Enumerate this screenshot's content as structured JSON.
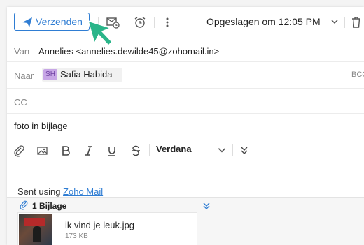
{
  "toolbar": {
    "send_label": "Verzenden",
    "saved_status": "Opgeslagen om 12:05 PM"
  },
  "fields": {
    "from_label": "Van",
    "from_value": "Annelies <annelies.dewilde45@zohomail.in>",
    "to_label": "Naar",
    "to_initials": "SH",
    "to_name": "Safia Habida",
    "bcc_label": "BCC",
    "cc_label": "CC",
    "subject": "foto in bijlage"
  },
  "format_toolbar": {
    "font": "Verdana"
  },
  "body": {
    "signature_prefix": "Sent using ",
    "signature_link": "Zoho Mail"
  },
  "attachments": {
    "count_label": "1 Bijlage",
    "items": [
      {
        "name": "ik vind je leuk.jpg",
        "size": "173 KB"
      }
    ]
  },
  "colors": {
    "accent": "#2f7dd3",
    "cursor": "#2bb58a"
  }
}
